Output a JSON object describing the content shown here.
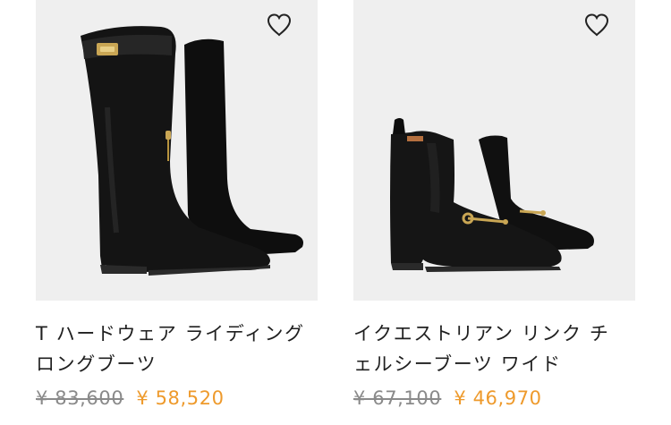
{
  "products": [
    {
      "title_line1": "T ハードウェア ライディング",
      "title_line2": "ロングブーツ",
      "old_price": "¥ 83,600",
      "sale_price": "¥ 58,520",
      "image_icon": "riding-boots-image",
      "wishlist_icon": "heart-outline-icon"
    },
    {
      "title_line1": "イクエストリアン リンク チ",
      "title_line2": "ェルシーブーツ ワイド",
      "old_price": "¥ 67,100",
      "sale_price": "¥ 46,970",
      "image_icon": "chelsea-boots-image",
      "wishlist_icon": "heart-outline-icon"
    }
  ],
  "colors": {
    "image_background": "#efefef",
    "sale_price": "#ee9a2c",
    "old_price": "#8a8a8a",
    "text": "#1f1f1f"
  }
}
